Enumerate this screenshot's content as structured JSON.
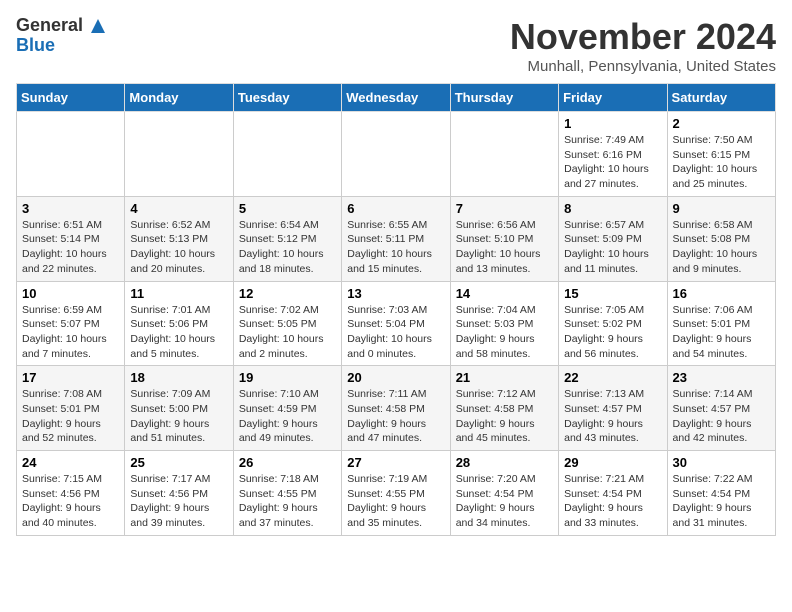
{
  "header": {
    "logo_line1": "General",
    "logo_line2": "Blue",
    "title": "November 2024",
    "subtitle": "Munhall, Pennsylvania, United States"
  },
  "days_of_week": [
    "Sunday",
    "Monday",
    "Tuesday",
    "Wednesday",
    "Thursday",
    "Friday",
    "Saturday"
  ],
  "weeks": [
    [
      {
        "day": "",
        "info": ""
      },
      {
        "day": "",
        "info": ""
      },
      {
        "day": "",
        "info": ""
      },
      {
        "day": "",
        "info": ""
      },
      {
        "day": "",
        "info": ""
      },
      {
        "day": "1",
        "info": "Sunrise: 7:49 AM\nSunset: 6:16 PM\nDaylight: 10 hours and 27 minutes."
      },
      {
        "day": "2",
        "info": "Sunrise: 7:50 AM\nSunset: 6:15 PM\nDaylight: 10 hours and 25 minutes."
      }
    ],
    [
      {
        "day": "3",
        "info": "Sunrise: 6:51 AM\nSunset: 5:14 PM\nDaylight: 10 hours and 22 minutes."
      },
      {
        "day": "4",
        "info": "Sunrise: 6:52 AM\nSunset: 5:13 PM\nDaylight: 10 hours and 20 minutes."
      },
      {
        "day": "5",
        "info": "Sunrise: 6:54 AM\nSunset: 5:12 PM\nDaylight: 10 hours and 18 minutes."
      },
      {
        "day": "6",
        "info": "Sunrise: 6:55 AM\nSunset: 5:11 PM\nDaylight: 10 hours and 15 minutes."
      },
      {
        "day": "7",
        "info": "Sunrise: 6:56 AM\nSunset: 5:10 PM\nDaylight: 10 hours and 13 minutes."
      },
      {
        "day": "8",
        "info": "Sunrise: 6:57 AM\nSunset: 5:09 PM\nDaylight: 10 hours and 11 minutes."
      },
      {
        "day": "9",
        "info": "Sunrise: 6:58 AM\nSunset: 5:08 PM\nDaylight: 10 hours and 9 minutes."
      }
    ],
    [
      {
        "day": "10",
        "info": "Sunrise: 6:59 AM\nSunset: 5:07 PM\nDaylight: 10 hours and 7 minutes."
      },
      {
        "day": "11",
        "info": "Sunrise: 7:01 AM\nSunset: 5:06 PM\nDaylight: 10 hours and 5 minutes."
      },
      {
        "day": "12",
        "info": "Sunrise: 7:02 AM\nSunset: 5:05 PM\nDaylight: 10 hours and 2 minutes."
      },
      {
        "day": "13",
        "info": "Sunrise: 7:03 AM\nSunset: 5:04 PM\nDaylight: 10 hours and 0 minutes."
      },
      {
        "day": "14",
        "info": "Sunrise: 7:04 AM\nSunset: 5:03 PM\nDaylight: 9 hours and 58 minutes."
      },
      {
        "day": "15",
        "info": "Sunrise: 7:05 AM\nSunset: 5:02 PM\nDaylight: 9 hours and 56 minutes."
      },
      {
        "day": "16",
        "info": "Sunrise: 7:06 AM\nSunset: 5:01 PM\nDaylight: 9 hours and 54 minutes."
      }
    ],
    [
      {
        "day": "17",
        "info": "Sunrise: 7:08 AM\nSunset: 5:01 PM\nDaylight: 9 hours and 52 minutes."
      },
      {
        "day": "18",
        "info": "Sunrise: 7:09 AM\nSunset: 5:00 PM\nDaylight: 9 hours and 51 minutes."
      },
      {
        "day": "19",
        "info": "Sunrise: 7:10 AM\nSunset: 4:59 PM\nDaylight: 9 hours and 49 minutes."
      },
      {
        "day": "20",
        "info": "Sunrise: 7:11 AM\nSunset: 4:58 PM\nDaylight: 9 hours and 47 minutes."
      },
      {
        "day": "21",
        "info": "Sunrise: 7:12 AM\nSunset: 4:58 PM\nDaylight: 9 hours and 45 minutes."
      },
      {
        "day": "22",
        "info": "Sunrise: 7:13 AM\nSunset: 4:57 PM\nDaylight: 9 hours and 43 minutes."
      },
      {
        "day": "23",
        "info": "Sunrise: 7:14 AM\nSunset: 4:57 PM\nDaylight: 9 hours and 42 minutes."
      }
    ],
    [
      {
        "day": "24",
        "info": "Sunrise: 7:15 AM\nSunset: 4:56 PM\nDaylight: 9 hours and 40 minutes."
      },
      {
        "day": "25",
        "info": "Sunrise: 7:17 AM\nSunset: 4:56 PM\nDaylight: 9 hours and 39 minutes."
      },
      {
        "day": "26",
        "info": "Sunrise: 7:18 AM\nSunset: 4:55 PM\nDaylight: 9 hours and 37 minutes."
      },
      {
        "day": "27",
        "info": "Sunrise: 7:19 AM\nSunset: 4:55 PM\nDaylight: 9 hours and 35 minutes."
      },
      {
        "day": "28",
        "info": "Sunrise: 7:20 AM\nSunset: 4:54 PM\nDaylight: 9 hours and 34 minutes."
      },
      {
        "day": "29",
        "info": "Sunrise: 7:21 AM\nSunset: 4:54 PM\nDaylight: 9 hours and 33 minutes."
      },
      {
        "day": "30",
        "info": "Sunrise: 7:22 AM\nSunset: 4:54 PM\nDaylight: 9 hours and 31 minutes."
      }
    ]
  ]
}
